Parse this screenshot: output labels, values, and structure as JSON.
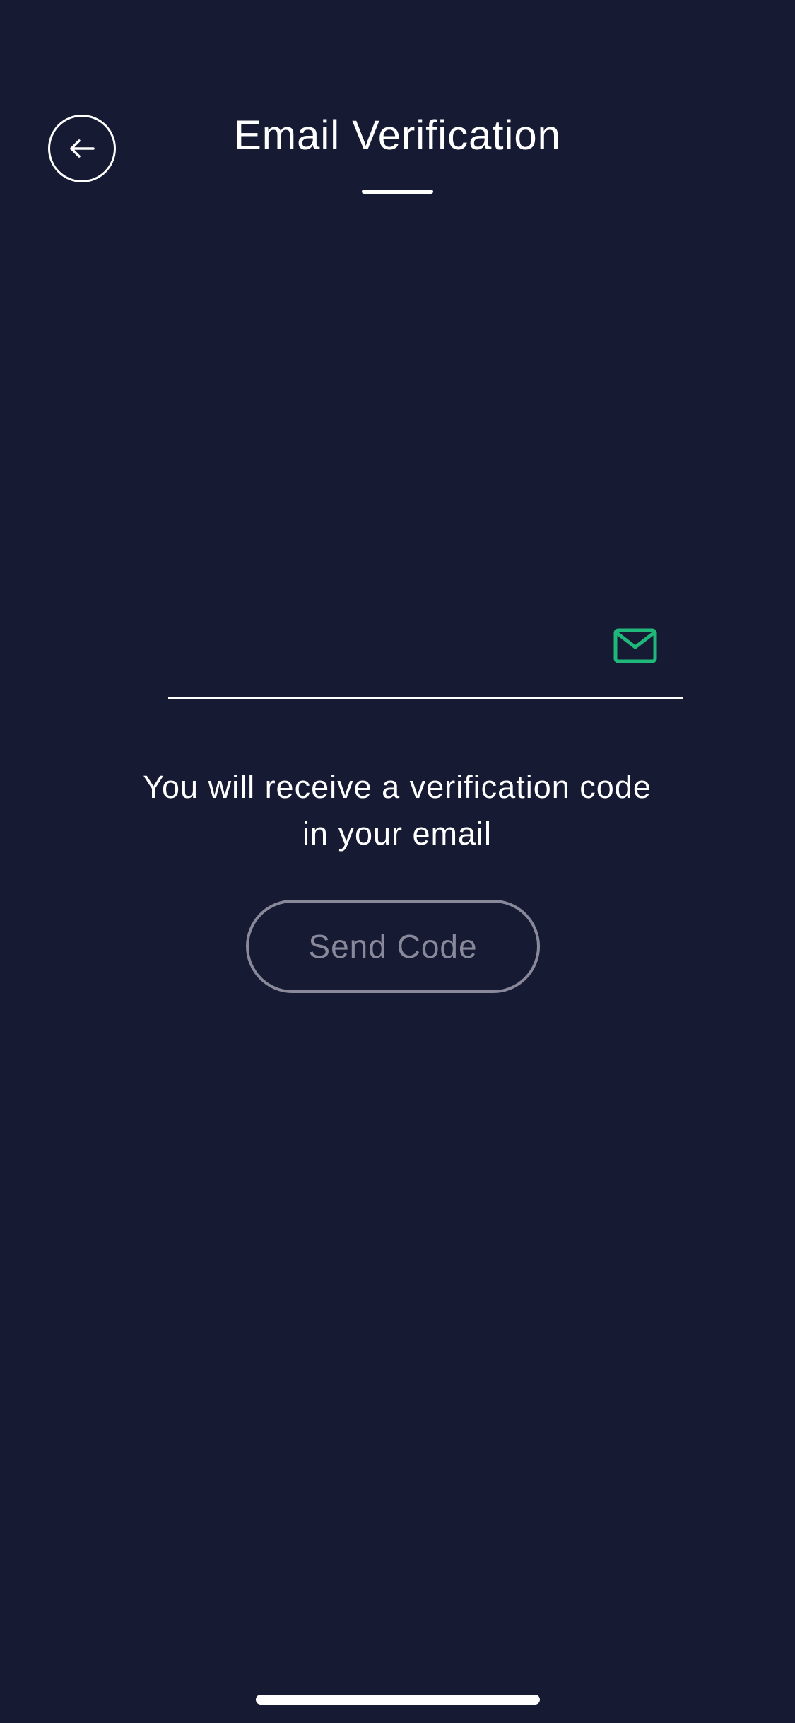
{
  "header": {
    "title": "Email Verification",
    "back_icon": "arrow-left-icon"
  },
  "email_field": {
    "value": "",
    "placeholder": "",
    "icon": "mail-icon",
    "icon_color": "#1fb87a"
  },
  "info": {
    "line1": "You will receive a verification code",
    "line2": "in your email"
  },
  "send_code_button": {
    "label": "Send Code",
    "state": "disabled"
  },
  "colors": {
    "background": "#161a33",
    "accent": "#1fb87a",
    "disabled": "#8a899b"
  }
}
